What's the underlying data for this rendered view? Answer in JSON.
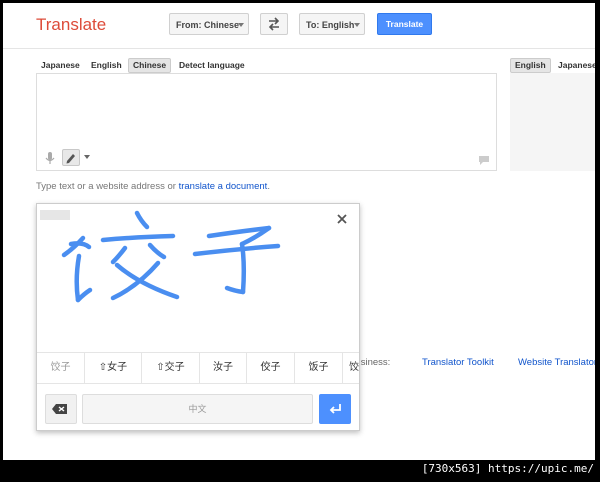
{
  "header": {
    "logo": "Translate",
    "from_label": "From: Chinese",
    "to_label": "To: English",
    "translate_button": "Translate"
  },
  "source_languages": [
    "Japanese",
    "English",
    "Chinese",
    "Detect language"
  ],
  "selected_source_language": "Chinese",
  "target_languages": [
    "English",
    "Japanese"
  ],
  "selected_target_language": "English",
  "source_input": {
    "value": "",
    "placeholder": ""
  },
  "hint": {
    "text": "Type text or a website address or ",
    "link": "translate a document",
    "suffix": "."
  },
  "footer": {
    "business_text": "or Business:",
    "translator_toolkit": "Translator Toolkit",
    "website_translator": "Website Translator"
  },
  "handwriting": {
    "candidates": [
      "饺子",
      "⇧女子",
      "⇧交子",
      "汝子",
      "佼子",
      "饭子",
      "饺"
    ],
    "space_label": "中文"
  },
  "icons": [
    "microphone-icon",
    "pencil-icon",
    "chevron-down-icon",
    "swap-icon",
    "feedback-icon",
    "close-icon",
    "backspace-icon",
    "enter-icon"
  ],
  "colors": {
    "logo": "#dd4b39",
    "accent": "#4d90fe",
    "ink": "#4a8ef0",
    "link": "#1155cc"
  },
  "watermark": "[730x563] https://upic.me/"
}
